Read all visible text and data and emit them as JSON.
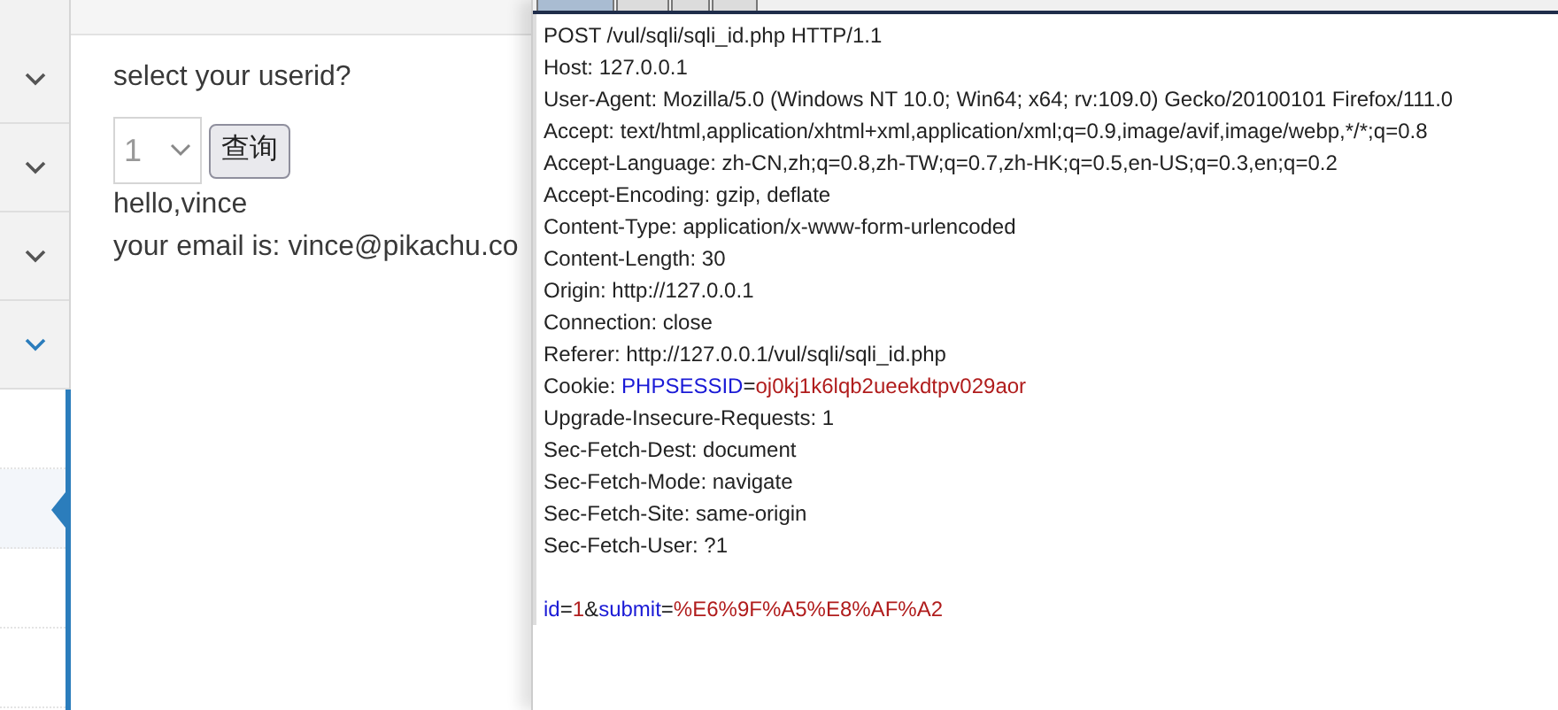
{
  "sidebar": {
    "groups": [
      {
        "active": false
      },
      {
        "active": false
      },
      {
        "active": false
      },
      {
        "active": true
      }
    ],
    "subitems": [
      {
        "selected": false
      },
      {
        "selected": true
      },
      {
        "selected": false
      },
      {
        "selected": false
      }
    ]
  },
  "content": {
    "prompt": "select your userid?",
    "select": {
      "value": "1"
    },
    "button": "查询",
    "result": [
      "hello,vince",
      "your email is: vince@pikachu.co"
    ]
  },
  "request_editor": {
    "tabs": [
      {
        "selected": true
      },
      {
        "selected": false
      },
      {
        "selected": false
      },
      {
        "selected": false
      }
    ],
    "headers": [
      [
        {
          "kind": "plain",
          "text": "POST /vul/sqli/sqli_id.php HTTP/1.1"
        }
      ],
      [
        {
          "kind": "plain",
          "text": "Host: 127.0.0.1"
        }
      ],
      [
        {
          "kind": "plain",
          "text": "User-Agent: Mozilla/5.0 (Windows NT 10.0; Win64; x64; rv:109.0) Gecko/20100101 Firefox/111.0"
        }
      ],
      [
        {
          "kind": "plain",
          "text": "Accept: text/html,application/xhtml+xml,application/xml;q=0.9,image/avif,image/webp,*/*;q=0.8"
        }
      ],
      [
        {
          "kind": "plain",
          "text": "Accept-Language: zh-CN,zh;q=0.8,zh-TW;q=0.7,zh-HK;q=0.5,en-US;q=0.3,en;q=0.2"
        }
      ],
      [
        {
          "kind": "plain",
          "text": "Accept-Encoding: gzip, deflate"
        }
      ],
      [
        {
          "kind": "plain",
          "text": "Content-Type: application/x-www-form-urlencoded"
        }
      ],
      [
        {
          "kind": "plain",
          "text": "Content-Length: 30"
        }
      ],
      [
        {
          "kind": "plain",
          "text": "Origin: http://127.0.0.1"
        }
      ],
      [
        {
          "kind": "plain",
          "text": "Connection: close"
        }
      ],
      [
        {
          "kind": "plain",
          "text": "Referer: http://127.0.0.1/vul/sqli/sqli_id.php"
        }
      ],
      [
        {
          "kind": "plain",
          "text": "Cookie: "
        },
        {
          "kind": "name",
          "text": "PHPSESSID"
        },
        {
          "kind": "plain",
          "text": "="
        },
        {
          "kind": "value",
          "text": "oj0kj1k6lqb2ueekdtpv029aor"
        }
      ],
      [
        {
          "kind": "plain",
          "text": "Upgrade-Insecure-Requests: 1"
        }
      ],
      [
        {
          "kind": "plain",
          "text": "Sec-Fetch-Dest: document"
        }
      ],
      [
        {
          "kind": "plain",
          "text": "Sec-Fetch-Mode: navigate"
        }
      ],
      [
        {
          "kind": "plain",
          "text": "Sec-Fetch-Site: same-origin"
        }
      ],
      [
        {
          "kind": "plain",
          "text": "Sec-Fetch-User: ?1"
        }
      ]
    ],
    "body": [
      {
        "kind": "name",
        "text": "id"
      },
      {
        "kind": "plain",
        "text": "="
      },
      {
        "kind": "value",
        "text": "1"
      },
      {
        "kind": "plain",
        "text": "&"
      },
      {
        "kind": "name",
        "text": "submit"
      },
      {
        "kind": "plain",
        "text": "="
      },
      {
        "kind": "value",
        "text": "%E6%9F%A5%E8%AF%A2"
      }
    ]
  }
}
